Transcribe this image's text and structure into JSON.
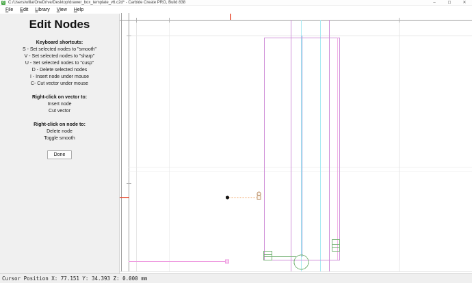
{
  "window": {
    "title": "C:/Users/willa/OneDrive/Desktop/drawer_box_template_v6.c2d* - Carbide Create PRO, Build 838",
    "app_icon_letter": "C",
    "minimize": "–",
    "maximize": "◻",
    "close": "✕"
  },
  "menu": {
    "items": [
      "File",
      "Edit",
      "Library",
      "View",
      "Help"
    ]
  },
  "panel": {
    "title": "Edit Nodes",
    "shortcuts_heading": "Keyboard shortcuts:",
    "shortcuts": [
      "S - Set selected nodes to \"smooth\"",
      "V - Set selected nodes to \"sharp\"",
      "U - Set selected nodes to \"cusp\"",
      "D - Delete selected nodes",
      "I - Insert node under mouse",
      "C- Cut vector under mouse"
    ],
    "vector_heading": "Right-click on vector to:",
    "vector_actions": [
      "Insert node",
      "Cut vector"
    ],
    "node_heading": "Right-click on node to:",
    "node_actions": [
      "Delete node",
      "Toggle smooth"
    ],
    "done_label": "Done"
  },
  "statusbar": {
    "cursor_position": "Cursor Position X: 77.151 Y: 34.393 Z: 0.000 mm"
  },
  "colors": {
    "job_edge": "#9b9b9b",
    "grid_light": "#e6e6e6",
    "tick_gray": "#b2b2b2",
    "cursor_tick": "#e64a2e",
    "geometry_magenta": "#cf8fd8",
    "geometry_pink": "#ee9ae0",
    "guide_cyan": "#a9eaf3",
    "guide_blue": "#8f9cd8",
    "toolpath_green": "#77b377",
    "control_orange": "#f0a160",
    "handle_tan": "#c09a75",
    "node_black": "#151515"
  }
}
